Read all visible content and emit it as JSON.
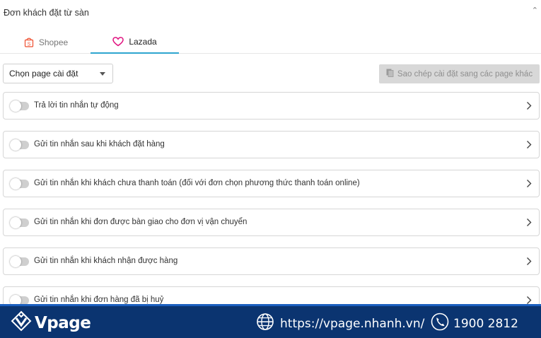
{
  "panel": {
    "title": "Đơn khách đặt từ sàn",
    "collapse_icon": "chevron-up-icon"
  },
  "tabs": [
    {
      "label": "Shopee",
      "icon": "shopee-bag-icon",
      "active": false,
      "color": "#ee4d2d"
    },
    {
      "label": "Lazada",
      "icon": "lazada-heart-icon",
      "active": true,
      "color": "#e0127f"
    }
  ],
  "accent_color": "#2ea5cf",
  "page_select": {
    "value": "Chọn page cài đặt"
  },
  "copy_button": {
    "label": "Sao chép cài đặt sang các page khác",
    "icon": "copy-document-icon",
    "disabled": true
  },
  "settings": [
    {
      "label": "Trả lời tin nhắn tự động",
      "enabled": false
    },
    {
      "label": "Gửi tin nhắn sau khi khách đặt hàng",
      "enabled": false
    },
    {
      "label": "Gửi tin nhắn khi khách chưa thanh toán (đối với đơn chọn phương thức thanh toán online)",
      "enabled": false
    },
    {
      "label": "Gửi tin nhắn khi đơn được bàn giao cho đơn vị vận chuyển",
      "enabled": false
    },
    {
      "label": "Gửi tin nhắn khi khách nhận được hàng",
      "enabled": false
    },
    {
      "label": "Gửi tin nhắn khi đơn hàng đã bị huỷ",
      "enabled": false
    }
  ],
  "footer": {
    "brand": "Vpage",
    "brand_icon": "vpage-logo-icon",
    "website": "https://vpage.nhanh.vn/",
    "website_icon": "globe-icon",
    "phone": "1900 2812",
    "phone_icon": "phone-icon",
    "background": "#0b3470"
  }
}
